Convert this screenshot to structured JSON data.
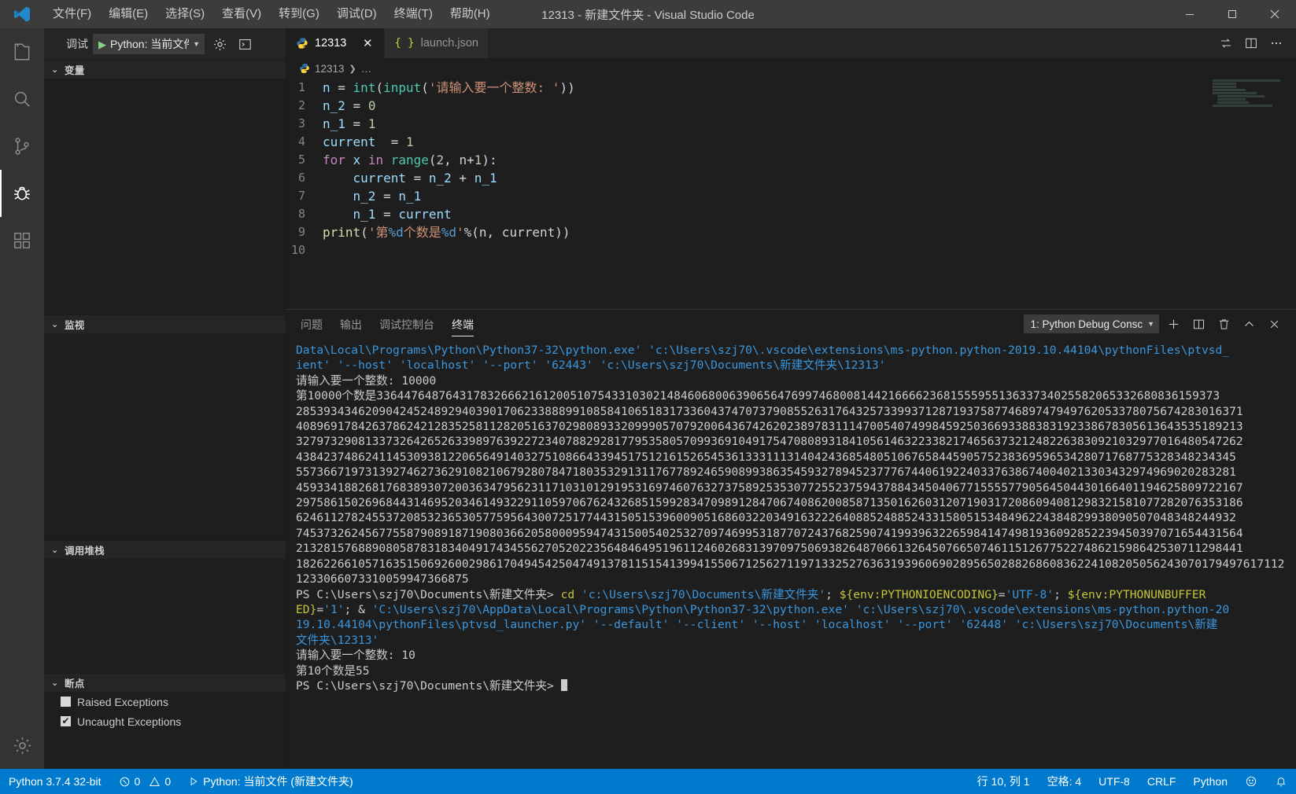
{
  "window": {
    "title": "12313 - 新建文件夹 - Visual Studio Code",
    "minimize": "–",
    "maximize": "□",
    "close": "✕"
  },
  "menu": {
    "items": [
      {
        "label": "文件(F)"
      },
      {
        "label": "编辑(E)"
      },
      {
        "label": "选择(S)"
      },
      {
        "label": "查看(V)"
      },
      {
        "label": "转到(G)"
      },
      {
        "label": "调试(D)"
      },
      {
        "label": "终端(T)"
      },
      {
        "label": "帮助(H)"
      }
    ]
  },
  "activitybar": {
    "items": [
      {
        "name": "explorer",
        "icon": "files-icon"
      },
      {
        "name": "search",
        "icon": "search-icon"
      },
      {
        "name": "source-control",
        "icon": "source-control-icon"
      },
      {
        "name": "debug",
        "icon": "debug-icon",
        "active": true
      },
      {
        "name": "extensions",
        "icon": "extensions-icon"
      }
    ],
    "manage": {
      "name": "manage",
      "icon": "gear-icon"
    }
  },
  "sidebar": {
    "debug_toolbar": {
      "label": "调试",
      "configuration": "Python: 当前文件",
      "play_icon": "play-icon",
      "caret_icon": "chevron-down-icon",
      "gear_icon": "gear-icon",
      "console_icon": "open-debug-console-icon"
    },
    "sections": [
      {
        "title": "变量"
      },
      {
        "title": "监视"
      },
      {
        "title": "调用堆栈"
      },
      {
        "title": "断点"
      }
    ],
    "breakpoints": [
      {
        "label": "Raised Exceptions",
        "checked": false
      },
      {
        "label": "Uncaught Exceptions",
        "checked": true
      }
    ]
  },
  "editor": {
    "tabs": [
      {
        "label": "12313",
        "icon": "python-icon",
        "active": true,
        "close": "✕"
      },
      {
        "label": "launch.json",
        "icon": "json-icon",
        "active": false
      }
    ],
    "tab_actions": [
      {
        "name": "split-sync-icon",
        "glyph": "⇄"
      },
      {
        "name": "split-editor-icon",
        "glyph": "▥"
      },
      {
        "name": "more-actions-icon",
        "glyph": "⋯"
      }
    ],
    "breadcrumb": {
      "file": "12313",
      "separator": "❯",
      "rest": "…",
      "icon": "python-icon"
    },
    "code_lines": [
      {
        "no": "1",
        "tokens": [
          {
            "t": "n",
            "c": "v"
          },
          {
            "t": " = ",
            "c": "p"
          },
          {
            "t": "int",
            "c": "b"
          },
          {
            "t": "(",
            "c": "p"
          },
          {
            "t": "input",
            "c": "b"
          },
          {
            "t": "(",
            "c": "p"
          },
          {
            "t": "'请输入要一个整数: '",
            "c": "s"
          },
          {
            "t": "))",
            "c": "p"
          }
        ]
      },
      {
        "no": "2",
        "tokens": [
          {
            "t": "n_2",
            "c": "v"
          },
          {
            "t": " = ",
            "c": "p"
          },
          {
            "t": "0",
            "c": "n"
          }
        ]
      },
      {
        "no": "3",
        "tokens": [
          {
            "t": "n_1",
            "c": "v"
          },
          {
            "t": " = ",
            "c": "p"
          },
          {
            "t": "1",
            "c": "n"
          }
        ]
      },
      {
        "no": "4",
        "tokens": [
          {
            "t": "current",
            "c": "v"
          },
          {
            "t": "  = ",
            "c": "p"
          },
          {
            "t": "1",
            "c": "n"
          }
        ]
      },
      {
        "no": "5",
        "tokens": [
          {
            "t": "for",
            "c": "k"
          },
          {
            "t": " x ",
            "c": "v"
          },
          {
            "t": "in",
            "c": "k"
          },
          {
            "t": " ",
            "c": "p"
          },
          {
            "t": "range",
            "c": "b"
          },
          {
            "t": "(",
            "c": "p"
          },
          {
            "t": "2",
            "c": "n"
          },
          {
            "t": ", n+",
            "c": "p"
          },
          {
            "t": "1",
            "c": "n"
          },
          {
            "t": "):",
            "c": "p"
          }
        ]
      },
      {
        "no": "6",
        "tokens": [
          {
            "t": "    current",
            "c": "v"
          },
          {
            "t": " = ",
            "c": "p"
          },
          {
            "t": "n_2",
            "c": "v"
          },
          {
            "t": " + ",
            "c": "p"
          },
          {
            "t": "n_1",
            "c": "v"
          }
        ]
      },
      {
        "no": "7",
        "tokens": [
          {
            "t": "    n_2",
            "c": "v"
          },
          {
            "t": " = ",
            "c": "p"
          },
          {
            "t": "n_1",
            "c": "v"
          }
        ]
      },
      {
        "no": "8",
        "tokens": [
          {
            "t": "    n_1",
            "c": "v"
          },
          {
            "t": " = ",
            "c": "p"
          },
          {
            "t": "current",
            "c": "v"
          }
        ]
      },
      {
        "no": "9",
        "tokens": [
          {
            "t": "print",
            "c": "fn"
          },
          {
            "t": "(",
            "c": "p"
          },
          {
            "t": "'第",
            "c": "s"
          },
          {
            "t": "%d",
            "c": "sf"
          },
          {
            "t": "个数是",
            "c": "s"
          },
          {
            "t": "%d",
            "c": "sf"
          },
          {
            "t": "'",
            "c": "s"
          },
          {
            "t": "%(n, current))",
            "c": "p"
          }
        ]
      },
      {
        "no": "10",
        "tokens": []
      }
    ]
  },
  "panel": {
    "tabs": [
      {
        "label": "问题",
        "active": false
      },
      {
        "label": "输出",
        "active": false
      },
      {
        "label": "调试控制台",
        "active": false
      },
      {
        "label": "终端",
        "active": true
      }
    ],
    "terminal_select": "1: Python Debug Consc",
    "actions": [
      {
        "name": "new-terminal-icon",
        "glyph": "+"
      },
      {
        "name": "split-terminal-icon",
        "glyph": "▥"
      },
      {
        "name": "kill-terminal-icon",
        "glyph": "🗑"
      },
      {
        "name": "maximize-panel-icon",
        "glyph": "⌃"
      },
      {
        "name": "close-panel-icon",
        "glyph": "✕"
      }
    ],
    "terminal_lines": [
      {
        "parts": [
          {
            "text": "Data\\Local\\Programs\\Python\\Python37-32\\python.exe' 'c:\\Users\\szj70\\.vscode\\extensions\\ms-python.python-2019.10.44104\\pythonFiles\\ptvsd_",
            "class": "t-cyan"
          }
        ]
      },
      {
        "parts": [
          {
            "text": "ient' '--host' 'localhost' '--port' '62443' 'c:\\Users\\szj70\\Documents\\新建文件夹\\12313'",
            "class": "t-cyan"
          }
        ]
      },
      {
        "parts": [
          {
            "text": "请输入要一个整数: 10000",
            "class": "t-white"
          }
        ]
      },
      {
        "parts": [
          {
            "text": "第10000个数是33644764876431783266621612005107543310302148460680063906564769974680081442166662368155595513633734025582065332680836159373",
            "class": "t-white"
          }
        ]
      },
      {
        "parts": [
          {
            "text": "28539343462090424524892940390170623388899108584106518317336043747073790855263176432573399371287193758774689747949762053378075674283016371",
            "class": "t-white"
          }
        ]
      },
      {
        "parts": [
          {
            "text": "40896917842637862421283525811282051637029808933209990570792006436742620238978311147005407499845925036693388383192338678305613643535189213",
            "class": "t-white"
          }
        ]
      },
      {
        "parts": [
          {
            "text": "32797329081337326426526339897639227234078829281779535805709936910491754708089318410561463223382174656373212482263830921032977016480547262",
            "class": "t-white"
          }
        ]
      },
      {
        "parts": [
          {
            "text": "4384237486241145309381220656491403275108664339451751216152654536133311131404243685480510676584459057523836959653428071768775328348234345",
            "class": "t-white"
          }
        ]
      },
      {
        "parts": [
          {
            "text": "5573667197313927462736291082106792807847180353291311767789246590899386354593278945237776744061922403376386740040213303432974969020283281",
            "class": "t-white"
          }
        ]
      },
      {
        "parts": [
          {
            "text": "45933418826817683893072003634795623117103101291953169746076327375892535307725523759437884345040677155557790564504430166401194625809722167",
            "class": "t-white"
          }
        ]
      },
      {
        "parts": [
          {
            "text": "29758615026968443146952034614932291105970676243268515992834709891284706740862008587135016260312071903172086094081298321581077282076353186",
            "class": "t-white"
          }
        ]
      },
      {
        "parts": [
          {
            "text": "6246112782455372085323653057759564300725177443150515396009051686032203491632226408852488524331580515348496224384829938090507048348244932",
            "class": "t-white"
          }
        ]
      },
      {
        "parts": [
          {
            "text": "74537326245677558790891871908036620580009594743150054025327097469953187707243768259074199396322659841474981936092852239450397071654431564",
            "class": "t-white"
          }
        ]
      },
      {
        "parts": [
          {
            "text": "21328157688908058783183404917434556270520223564846495196112460268313970975069382648706613264507665074611512677522748621598642530711298441",
            "class": "t-white"
          }
        ]
      },
      {
        "parts": [
          {
            "text": "182622661057163515069260029861704945425047491378115154139941550671256271197133252763631939606902895650288268608362241082050562430701794976171121233066073310059947366875",
            "class": "t-white"
          }
        ]
      },
      {
        "parts": [
          {
            "text": "PS C:\\Users\\szj70\\Documents\\新建文件夹> ",
            "class": "t-white"
          },
          {
            "text": "cd",
            "class": "t-yellow"
          },
          {
            "text": " 'c:\\Users\\szj70\\Documents\\新建文件夹'",
            "class": "t-cyan"
          },
          {
            "text": "; ",
            "class": "t-white"
          },
          {
            "text": "${env:PYTHONIOENCODING}",
            "class": "t-yellow"
          },
          {
            "text": "=",
            "class": "t-white"
          },
          {
            "text": "'UTF-8'",
            "class": "t-cyan"
          },
          {
            "text": "; ",
            "class": "t-white"
          },
          {
            "text": "${env:PYTHONUNBUFFER",
            "class": "t-yellow"
          }
        ]
      },
      {
        "parts": [
          {
            "text": "ED}",
            "class": "t-yellow"
          },
          {
            "text": "=",
            "class": "t-white"
          },
          {
            "text": "'1'",
            "class": "t-cyan"
          },
          {
            "text": "; & ",
            "class": "t-white"
          },
          {
            "text": "'C:\\Users\\szj70\\AppData\\Local\\Programs\\Python\\Python37-32\\python.exe' 'c:\\Users\\szj70\\.vscode\\extensions\\ms-python.python-20",
            "class": "t-cyan"
          }
        ]
      },
      {
        "parts": [
          {
            "text": "19.10.44104\\pythonFiles\\ptvsd_launcher.py' '--default' '--client' '--host' 'localhost' '--port' '62448' 'c:\\Users\\szj70\\Documents\\新建",
            "class": "t-cyan"
          }
        ]
      },
      {
        "parts": [
          {
            "text": "文件夹\\12313'",
            "class": "t-cyan"
          }
        ]
      },
      {
        "parts": [
          {
            "text": "请输入要一个整数: 10",
            "class": "t-white"
          }
        ]
      },
      {
        "parts": [
          {
            "text": "第10个数是55",
            "class": "t-white"
          }
        ]
      },
      {
        "parts": [
          {
            "text": "PS C:\\Users\\szj70\\Documents\\新建文件夹> ",
            "class": "t-white"
          }
        ],
        "cursor": true
      }
    ]
  },
  "statusbar": {
    "left": [
      {
        "name": "python-version",
        "label": "Python 3.7.4 32-bit"
      },
      {
        "name": "problems",
        "label": "0",
        "label2": "0",
        "icon": "error-icon",
        "icon2": "warning-icon"
      },
      {
        "name": "debug-launch",
        "label": "Python: 当前文件 (新建文件夹)",
        "icon": "play-icon"
      }
    ],
    "right": [
      {
        "name": "cursor-position",
        "label": "行 10, 列 1"
      },
      {
        "name": "indentation",
        "label": "空格: 4"
      },
      {
        "name": "encoding",
        "label": "UTF-8"
      },
      {
        "name": "eol",
        "label": "CRLF"
      },
      {
        "name": "language-mode",
        "label": "Python"
      },
      {
        "name": "feedback",
        "label": "☺"
      },
      {
        "name": "notifications",
        "label": "🔔"
      }
    ]
  },
  "colors": {
    "statusbar_bg": "#007acc",
    "titlebar_bg": "#3c3c3c",
    "sidebar_bg": "#252526",
    "editor_bg": "#1e1e1e",
    "activitybar_bg": "#333333"
  }
}
